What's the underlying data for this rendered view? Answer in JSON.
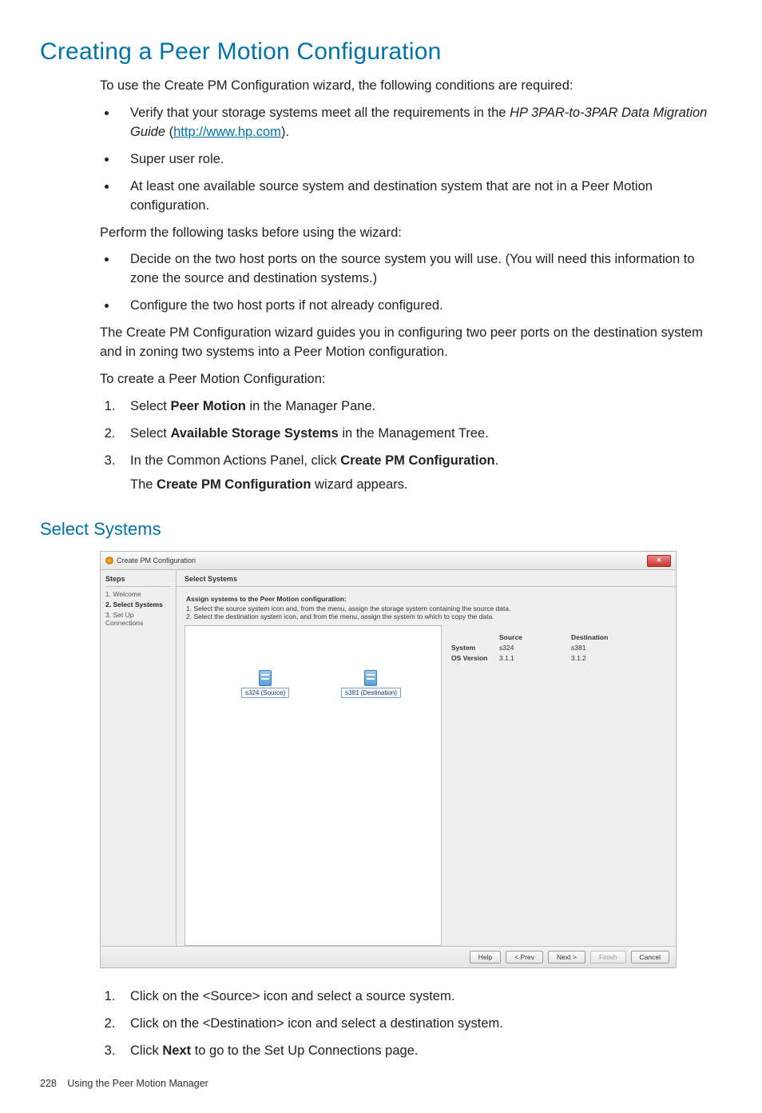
{
  "title": "Creating a Peer Motion Configuration",
  "intro": "To use the Create PM Configuration wizard, the following conditions are required:",
  "bullets1": {
    "b1a": "Verify that your storage systems meet all the requirements in the ",
    "b1b_italic": "HP 3PAR-to-3PAR Data Migration Guide",
    "b1c": " (",
    "b1_link": "http://www.hp.com",
    "b1d": ").",
    "b2": "Super user role.",
    "b3": "At least one available source system and destination system that are not in a Peer Motion configuration."
  },
  "para2": "Perform the following tasks before using the wizard:",
  "bullets2": {
    "b1": "Decide on the two host ports on the source system you will use. (You will need this information to zone the source and destination systems.)",
    "b2": "Configure the two host ports if not already configured."
  },
  "para3": "The Create PM Configuration wizard guides you in configuring two peer ports on the destination system and in zoning two systems into a Peer Motion configuration.",
  "para4": "To create a Peer Motion Configuration:",
  "steps_top": {
    "s1a": "Select ",
    "s1b_bold": "Peer Motion",
    "s1c": " in the Manager Pane.",
    "s2a": "Select ",
    "s2b_bold": "Available Storage Systems",
    "s2c": " in the Management Tree.",
    "s3a": "In the Common Actions Panel, click ",
    "s3b_bold": "Create PM Configuration",
    "s3c": ".",
    "s3suba": "The ",
    "s3subb_bold": "Create PM Configuration",
    "s3subc": " wizard appears."
  },
  "subtitle": "Select Systems",
  "wizard": {
    "title": "Create PM Configuration",
    "close_glyph": "✕",
    "steps_header": "Steps",
    "steps": [
      "1. Welcome",
      "2. Select Systems",
      "3. Set Up Connections"
    ],
    "active_step_index": 1,
    "panel_header": "Select Systems",
    "instr_bold": "Assign systems to the Peer Motion configuration:",
    "instr1": "1. Select the source system icon and, from the menu, assign the storage system containing the source data.",
    "instr2": "2. Select the destination system icon, and from the menu, assign the system to which to copy the data.",
    "src_label": "s324 (Source)",
    "dst_label": "s381 (Destination)",
    "grid": {
      "h_source": "Source",
      "h_dest": "Destination",
      "r_system": "System",
      "r_system_src": "s324",
      "r_system_dst": "s381",
      "r_os": "OS Version",
      "r_os_src": "3.1.1",
      "r_os_dst": "3.1.2"
    },
    "buttons": {
      "help": "Help",
      "prev": "< Prev",
      "next": "Next >",
      "finish": "Finish",
      "cancel": "Cancel"
    }
  },
  "steps_bottom": {
    "s1": "Click on the <Source> icon and select a source system.",
    "s2": "Click on the <Destination> icon and select a destination system.",
    "s3a": "Click ",
    "s3b_bold": "Next",
    "s3c": " to go to the Set Up Connections page."
  },
  "footer": {
    "page": "228",
    "section": "Using the Peer Motion Manager"
  }
}
